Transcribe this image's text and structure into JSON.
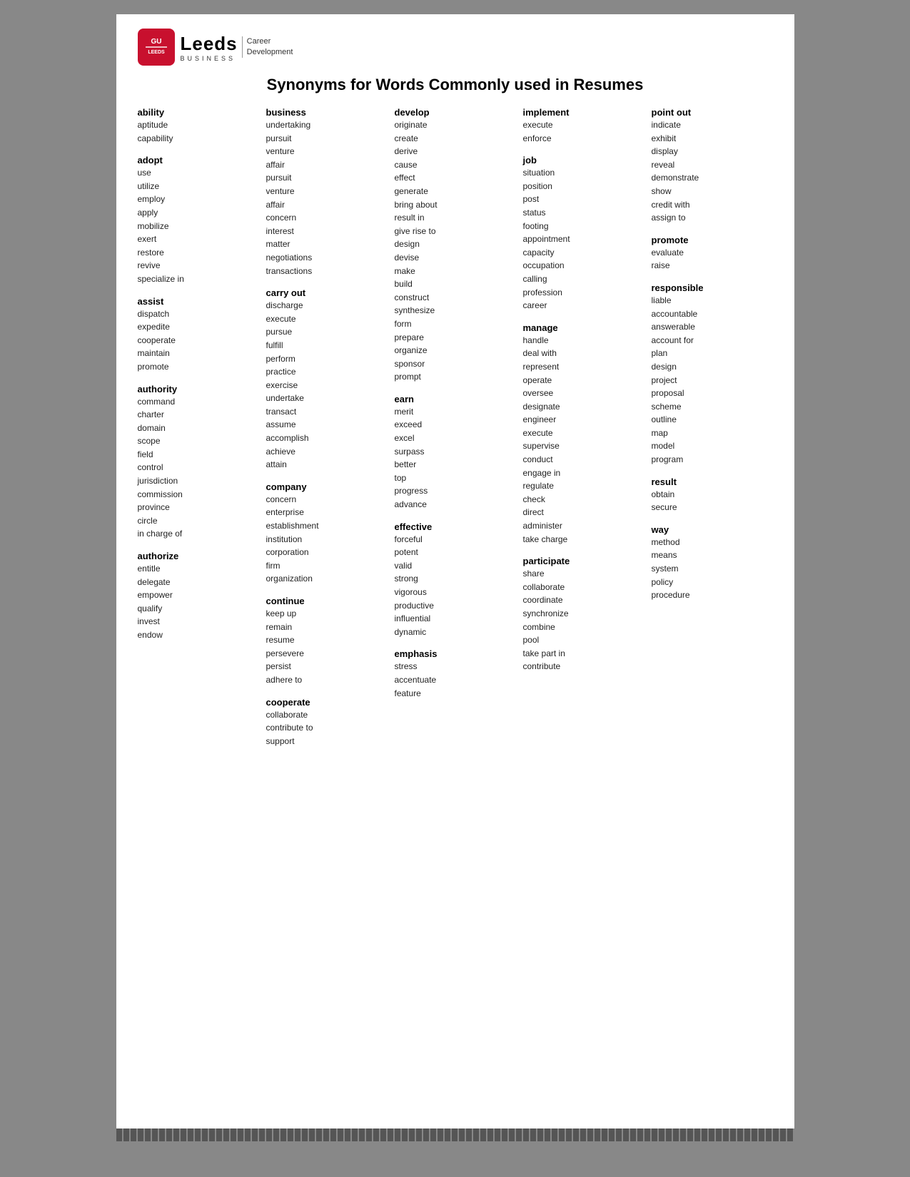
{
  "header": {
    "logo_line1": "GU",
    "logo_line2": "Leeds",
    "business_label": "BUSINESS",
    "career_label": "Career",
    "development_label": "Development"
  },
  "title": "Synonyms for Words Commonly used in Resumes",
  "columns": [
    {
      "groups": [
        {
          "heading": "ability",
          "synonyms": [
            "aptitude",
            "capability"
          ]
        },
        {
          "heading": "adopt",
          "synonyms": [
            "use",
            "utilize",
            "employ",
            "apply",
            "mobilize",
            "exert",
            "restore",
            "revive",
            "specialize in"
          ]
        },
        {
          "heading": "assist",
          "synonyms": [
            "dispatch",
            "expedite",
            "cooperate",
            "maintain",
            "promote"
          ]
        },
        {
          "heading": "authority",
          "synonyms": [
            "command",
            "charter",
            "domain",
            "scope",
            "field",
            "control",
            "jurisdiction",
            "commission",
            "province",
            "circle",
            "in charge of"
          ]
        },
        {
          "heading": "authorize",
          "synonyms": [
            "entitle",
            "delegate",
            "empower",
            "qualify",
            "invest",
            "endow"
          ]
        }
      ]
    },
    {
      "groups": [
        {
          "heading": "business",
          "synonyms": [
            "undertaking",
            "pursuit",
            "venture",
            "affair",
            "pursuit",
            "venture",
            "affair",
            "concern",
            "interest",
            "matter",
            "negotiations",
            "transactions"
          ]
        },
        {
          "heading": "carry out",
          "synonyms": [
            "discharge",
            "execute",
            "pursue",
            "fulfill",
            "perform",
            "practice",
            "    exercise",
            "undertake",
            "transact",
            "assume",
            "accomplish",
            "achieve",
            "attain"
          ]
        },
        {
          "heading": "company",
          "synonyms": [
            "concern",
            "enterprise",
            "establishment",
            "institution",
            "corporation",
            "firm",
            "organization"
          ]
        },
        {
          "heading": "continue",
          "synonyms": [
            "keep up",
            "remain",
            "resume",
            "persevere",
            "persist",
            "adhere to"
          ]
        },
        {
          "heading": "cooperate",
          "synonyms": [
            "collaborate",
            "contribute to",
            "support"
          ]
        }
      ]
    },
    {
      "groups": [
        {
          "heading": "develop",
          "synonyms": [
            "originate",
            "create",
            "derive",
            "cause",
            "effect",
            "generate",
            "bring about",
            "result in",
            "give rise to",
            "design",
            "devise",
            "make",
            "build",
            "construct",
            "synthesize",
            "form",
            "prepare",
            "organize",
            "sponsor",
            "prompt"
          ]
        },
        {
          "heading": "earn",
          "synonyms": [
            "merit",
            "exceed",
            "excel",
            "surpass",
            "better",
            "top",
            "progress",
            "advance"
          ]
        },
        {
          "heading": "effective",
          "synonyms": [
            "forceful",
            "potent",
            "valid",
            "strong",
            "vigorous",
            "productive",
            "influential",
            "dynamic"
          ]
        },
        {
          "heading": "emphasis",
          "synonyms": [
            "stress",
            "accentuate",
            "feature"
          ]
        }
      ]
    },
    {
      "groups": [
        {
          "heading": "implement",
          "synonyms": [
            "execute",
            "enforce"
          ]
        },
        {
          "heading": "job",
          "synonyms": [
            "situation",
            "position",
            "post",
            "status",
            "footing",
            "appointment",
            "capacity",
            "occupation",
            "calling",
            "profession",
            "career"
          ]
        },
        {
          "heading": "manage",
          "synonyms": [
            "handle",
            "deal with",
            "represent",
            "operate",
            "oversee",
            "designate",
            "engineer",
            "execute",
            "supervise",
            "conduct",
            "engage in",
            "regulate",
            "check",
            "direct",
            "administer",
            "take charge"
          ]
        },
        {
          "heading": "participate",
          "synonyms": [
            "share",
            "collaborate",
            "coordinate",
            "synchronize",
            "combine",
            "pool",
            "take part in",
            "contribute"
          ]
        }
      ]
    },
    {
      "groups": [
        {
          "heading": "point out",
          "synonyms": [
            "indicate",
            "exhibit",
            "display",
            "reveal",
            "demonstrate",
            "show",
            "credit with",
            "assign to"
          ]
        },
        {
          "heading": "promote",
          "synonyms": [
            "evaluate",
            "raise"
          ]
        },
        {
          "heading": "responsible",
          "synonyms": [
            "liable",
            "accountable",
            "answerable",
            "account for",
            "plan",
            "design",
            "project",
            "proposal",
            "scheme",
            "outline",
            "map",
            "model",
            "program"
          ]
        },
        {
          "heading": "result",
          "synonyms": [
            "obtain",
            "secure"
          ]
        },
        {
          "heading": "way",
          "synonyms": [
            "method",
            "means",
            "system",
            "policy",
            "procedure"
          ]
        }
      ]
    }
  ]
}
